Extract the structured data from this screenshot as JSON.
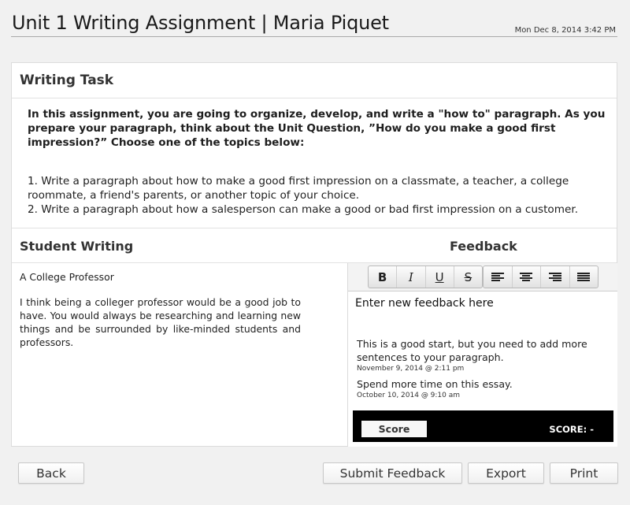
{
  "header": {
    "title": "Unit 1 Writing Assignment | Maria Piquet",
    "date": "Mon Dec 8, 2014 3:42 PM"
  },
  "task": {
    "heading": "Writing Task",
    "intro": "In this assignment, you are going to organize, develop, and write a \"how to\" paragraph. As you prepare your paragraph, think about the Unit Question, ”How do you make a good first impression?”  Choose one of the topics below:",
    "options": [
      "1. Write a paragraph about how to make a good first impression on a classmate, a teacher, a college roommate, a friend's parents, or another topic of your choice.",
      "2. Write a paragraph about how a salesperson can make a good or bad first impression on a customer."
    ]
  },
  "student": {
    "heading": "Student Writing",
    "essay_title": "A College Professor",
    "essay_text": "I think being a colleger professor would be a good job to have. You would always be researching and learning new things and be surrounded by like-minded students and professors."
  },
  "feedback": {
    "heading": "Feedback",
    "toolbar": {
      "bold": "B",
      "italic": "I",
      "underline": "U",
      "strike": "S",
      "icons": [
        "align-left-icon",
        "align-center-icon",
        "align-right-icon",
        "align-justify-icon"
      ]
    },
    "input_placeholder": "Enter new feedback here",
    "items": [
      {
        "text": "This is a good start, but you need to add more sentences to your paragraph.",
        "date": "November 9, 2014 @ 2:11 pm"
      },
      {
        "text": "Spend more time on this essay.",
        "date": "October 10, 2014 @ 9:10 am"
      }
    ],
    "score_button": "Score",
    "score_label": "SCORE: -"
  },
  "buttons": {
    "back": "Back",
    "submit": "Submit Feedback",
    "export": "Export",
    "print": "Print"
  }
}
